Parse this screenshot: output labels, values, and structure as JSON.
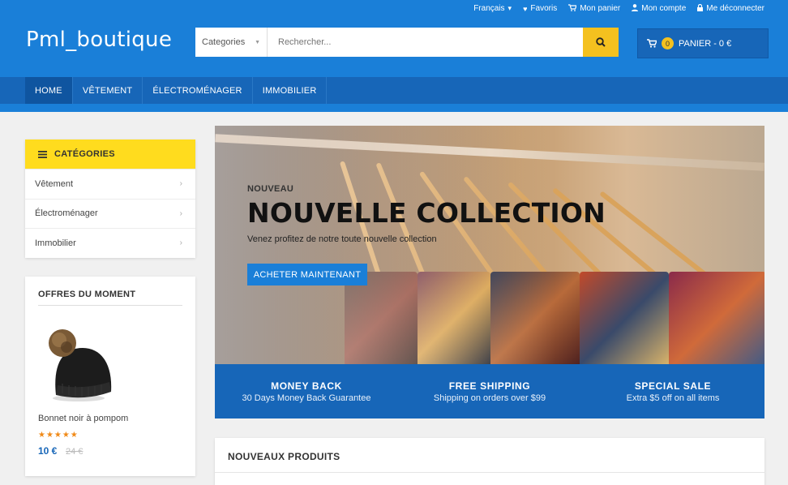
{
  "topbar": {
    "language": "Français",
    "favorites": "Favoris",
    "cart": "Mon panier",
    "account": "Mon compte",
    "logout": "Me déconnecter"
  },
  "header": {
    "logo": "Pml_boutique",
    "search": {
      "category": "Categories",
      "placeholder": "Rechercher..."
    },
    "cart": {
      "count": "0",
      "label": "PANIER - 0 €"
    }
  },
  "nav": {
    "tabs": [
      "HOME",
      "VÊTEMENT",
      "ÉLECTROMÉNAGER",
      "IMMOBILIER"
    ]
  },
  "sidebar": {
    "categories_title": "CATÉGORIES",
    "categories": [
      "Vêtement",
      "Électroménager",
      "Immobilier"
    ],
    "offers": {
      "title": "OFFRES DU MOMENT",
      "product": "Bonnet noir à pompom",
      "rating": 5,
      "stars": "★★★★★",
      "price": "10 €",
      "old_price": "24 €"
    }
  },
  "banner": {
    "kicker": "NOUVEAU",
    "headline": "NOUVELLE COLLECTION",
    "subtitle": "Venez profitez de notre toute nouvelle collection",
    "cta": "ACHETER MAINTENANT"
  },
  "features": [
    {
      "title": "MONEY BACK",
      "desc": "30 Days Money Back Guarantee"
    },
    {
      "title": "FREE SHIPPING",
      "desc": "Shipping on orders over $99"
    },
    {
      "title": "SPECIAL SALE",
      "desc": "Extra $5 off on all items"
    }
  ],
  "new_products": {
    "title": "NOUVEAUX PRODUITS"
  },
  "colors": {
    "primary": "#1a7fd8",
    "primary_dark": "#1766b8",
    "accent": "#ffdc1e",
    "star": "#f08a18"
  }
}
